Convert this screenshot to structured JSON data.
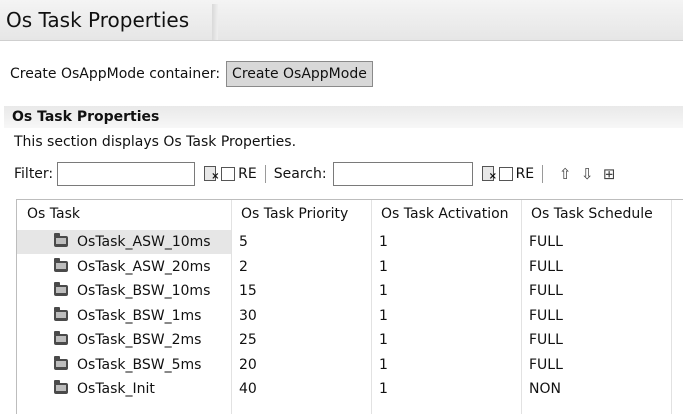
{
  "window": {
    "title": "Os Task Properties"
  },
  "create": {
    "label": "Create OsAppMode container:",
    "button": "Create OsAppMode"
  },
  "section": {
    "heading": "Os Task Properties",
    "description": "This section displays Os Task Properties."
  },
  "filter": {
    "filter_label": "Filter:",
    "filter_value": "",
    "re_label": "RE",
    "search_label": "Search:",
    "search_value": "",
    "search_re_label": "RE"
  },
  "toolbar_icons": [
    "move-up-icon",
    "move-down-icon",
    "expand-all-icon"
  ],
  "table": {
    "columns": [
      "Os Task",
      "Os Task Priority",
      "Os Task Activation",
      "Os Task Schedule"
    ],
    "rows": [
      {
        "name": "OsTask_ASW_10ms",
        "priority": "5",
        "activation": "1",
        "schedule": "FULL"
      },
      {
        "name": "OsTask_ASW_20ms",
        "priority": "2",
        "activation": "1",
        "schedule": "FULL"
      },
      {
        "name": "OsTask_BSW_10ms",
        "priority": "15",
        "activation": "1",
        "schedule": "FULL"
      },
      {
        "name": "OsTask_BSW_1ms",
        "priority": "30",
        "activation": "1",
        "schedule": "FULL"
      },
      {
        "name": "OsTask_BSW_2ms",
        "priority": "25",
        "activation": "1",
        "schedule": "FULL"
      },
      {
        "name": "OsTask_BSW_5ms",
        "priority": "20",
        "activation": "1",
        "schedule": "FULL"
      },
      {
        "name": "OsTask_Init",
        "priority": "40",
        "activation": "1",
        "schedule": "NON"
      }
    ],
    "selected_row": 0
  }
}
